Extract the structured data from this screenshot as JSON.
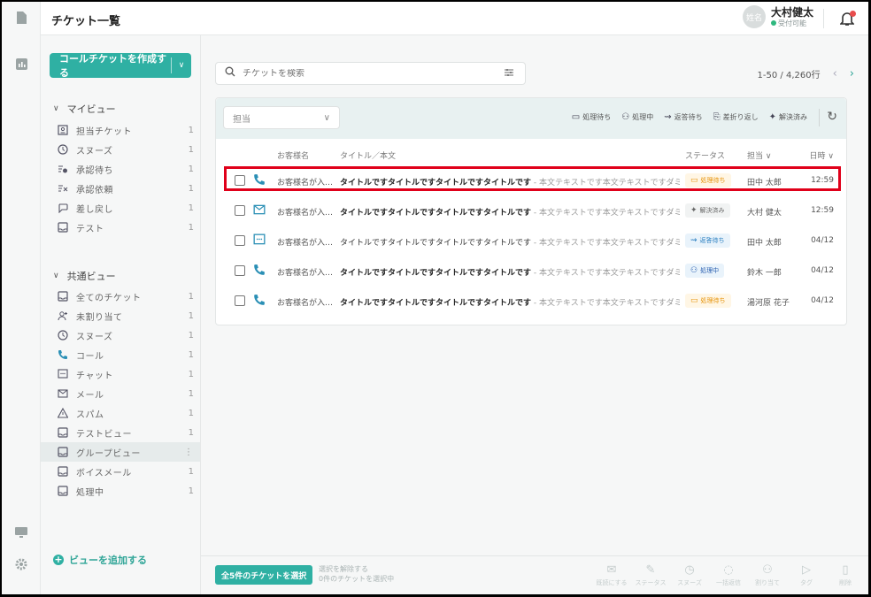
{
  "header": {
    "title": "チケット一覧"
  },
  "user": {
    "avatar_text": "姓名",
    "name": "大村健太",
    "status": "受付可能"
  },
  "sidebar": {
    "create_label": "コールチケットを作成する",
    "my_view_label": "マイビュー",
    "my_items": [
      {
        "label": "担当チケット",
        "count": "1"
      },
      {
        "label": "スヌーズ",
        "count": "1"
      },
      {
        "label": "承認待ち",
        "count": "1"
      },
      {
        "label": "承認依頼",
        "count": "1"
      },
      {
        "label": "差し戻し",
        "count": "1"
      },
      {
        "label": "テスト",
        "count": "1"
      }
    ],
    "shared_view_label": "共通ビュー",
    "shared_items": [
      {
        "label": "全てのチケット",
        "count": "1"
      },
      {
        "label": "未割り当て",
        "count": "1"
      },
      {
        "label": "スヌーズ",
        "count": "1"
      },
      {
        "label": "コール",
        "count": "1"
      },
      {
        "label": "チャット",
        "count": "1"
      },
      {
        "label": "メール",
        "count": "1"
      },
      {
        "label": "スパム",
        "count": "1"
      },
      {
        "label": "テストビュー",
        "count": "1"
      },
      {
        "label": "グループビュー",
        "count": "⋮"
      },
      {
        "label": "ボイスメール",
        "count": "1"
      },
      {
        "label": "処理中",
        "count": "1"
      }
    ],
    "add_view_label": "ビューを追加する"
  },
  "search": {
    "placeholder": "チケットを検索"
  },
  "pager": {
    "range": "1-50 / 4,260行"
  },
  "toolbar": {
    "assignee_label": "担当",
    "filters": [
      {
        "icon": "inbox-icon",
        "label": "処理待ち"
      },
      {
        "icon": "agent-icon",
        "label": "処理中"
      },
      {
        "icon": "reply-wait-icon",
        "label": "返答待ち"
      },
      {
        "icon": "sendback-icon",
        "label": "差折り返し"
      },
      {
        "icon": "sparkle-icon",
        "label": "解決済み"
      }
    ]
  },
  "table": {
    "headers": {
      "customer": "お客様名",
      "title": "タイトル／本文",
      "status": "ステータス",
      "assignee": "担当 ∨",
      "time": "日時 ∨"
    },
    "rows": [
      {
        "channel": "phone",
        "customer": "お客様名が入…",
        "title": "タイトルですタイトルですタイトルですタイトルです",
        "body": " - 本文テキストです本文テキストですダミーテ…",
        "status": "処理待ち",
        "status_kind": "waiting",
        "assignee": "田中 太郎",
        "time": "12:59"
      },
      {
        "channel": "mail",
        "customer": "お客様名が入…",
        "title": "タイトルですタイトルですタイトルですタイトルです",
        "body": " - 本文テキストです本文テキストですダミーテ…",
        "status": "解決済み",
        "status_kind": "resolved",
        "assignee": "大村 健太",
        "time": "12:59"
      },
      {
        "channel": "chat",
        "customer": "お客様名が入…",
        "title": "タイトルですタイトルですタイトルですタイトルです",
        "body": " - 本文テキストです本文テキストですダミーテ…",
        "status": "返答待ち",
        "status_kind": "reply",
        "assignee": "田中 太郎",
        "time": "04/12"
      },
      {
        "channel": "phone",
        "customer": "お客様名が入…",
        "title": "タイトルですタイトルですタイトルですタイトルです",
        "body": " - 本文テキストです本文テキストですダミーテ…",
        "status": "処理中",
        "status_kind": "progress",
        "assignee": "鈴木 一郎",
        "time": "04/12"
      },
      {
        "channel": "phone",
        "customer": "お客様名が入…",
        "title": "タイトルですタイトルですタイトルですタイトルです",
        "body": " - 本文テキストです本文テキストですダミーテ…",
        "status": "処理待ち",
        "status_kind": "waiting",
        "assignee": "湯河原 花子",
        "time": "04/12"
      }
    ]
  },
  "bottom": {
    "select_all": "全5件のチケットを選択",
    "deselect": "選択を解除する",
    "selected_count": "0件のチケットを選択中",
    "actions": [
      "既読にする",
      "ステータス",
      "スヌーズ",
      "一括返信",
      "割り当て",
      "タグ",
      "削除"
    ]
  },
  "colors": {
    "accent": "#2fb0a3",
    "highlight": "#e0001a"
  }
}
